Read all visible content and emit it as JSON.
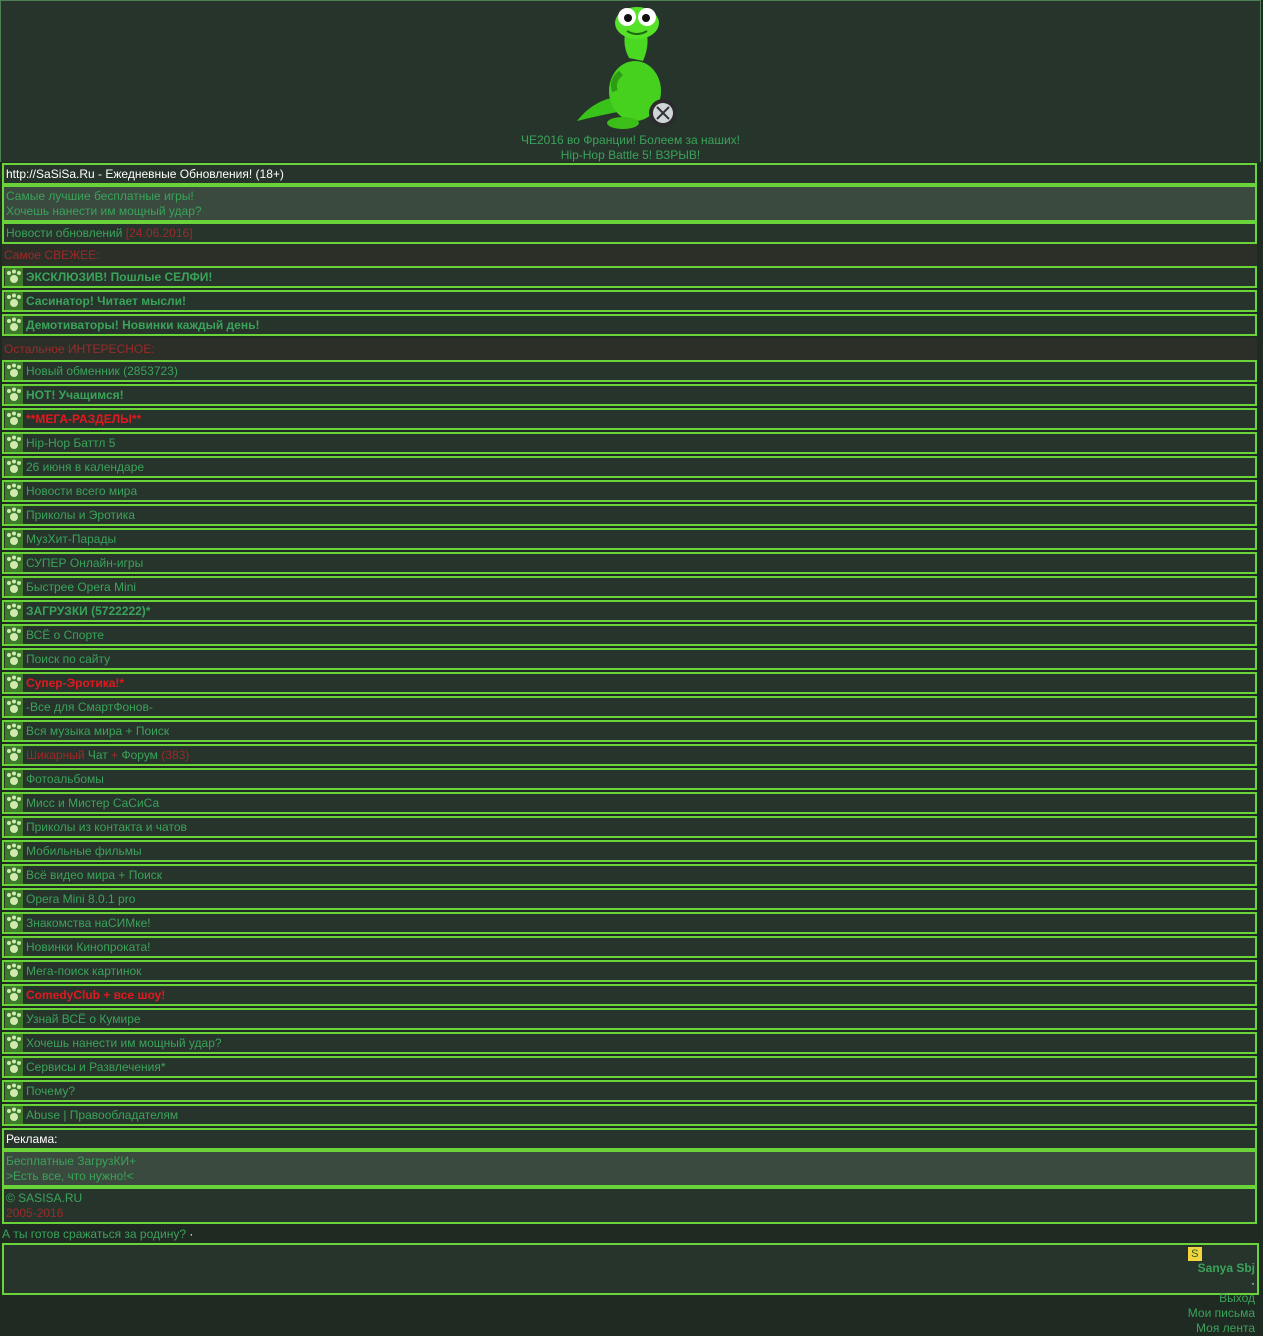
{
  "header": {
    "links": [
      "ЧЕ2016 во Франции! Болеем за наших!",
      "Hip-Hop Battle 5! ВЗРЫВ!"
    ]
  },
  "site_title": "http://SaSiSa.Ru - Ежедневные Обновления! (18+)",
  "promo1": [
    "Самые лучшие бесплатные игры!",
    "Хочешь нанести им мощный удар?"
  ],
  "news": {
    "label": "Новости обновлений",
    "date": "[24.06.2016]"
  },
  "section_hot": "Самое СВЕЖЕЕ:",
  "hot_items": [
    "ЭКСКЛЮЗИВ! Пошлые СЕЛФИ!",
    "Сасинатор! Читает мысли!",
    "Демотиваторы! Новинки каждый день!"
  ],
  "section_other": "Остальное ИНТЕРЕСНОЕ:",
  "items": [
    {
      "label": "Новый обменник (2853723)",
      "style": "normal"
    },
    {
      "label": "НОТ! Учащимся!",
      "style": "bold"
    },
    {
      "label": "**МЕГА-РАЗДЕЛЫ**",
      "style": "red-bold"
    },
    {
      "label": "Hip-Hop Баттл 5",
      "style": "normal"
    },
    {
      "label": "26 июня в календаре",
      "style": "normal"
    },
    {
      "label": "Новости всего мира",
      "style": "normal"
    },
    {
      "label": "Приколы и Эротика",
      "style": "normal"
    },
    {
      "label": "МузХит-Парады",
      "style": "normal"
    },
    {
      "label": "СУПЕР Онлайн-игры",
      "style": "normal"
    },
    {
      "label": "Быстрее Opera Mini",
      "style": "normal"
    },
    {
      "label": "ЗАГРУЗКИ (5722222)*",
      "style": "bold"
    },
    {
      "label": "ВСЁ о Спорте",
      "style": "normal"
    },
    {
      "label": "Поиск по сайту",
      "style": "normal"
    },
    {
      "label": "Супер-Эротика!*",
      "style": "red-bold"
    },
    {
      "label": "-Все для СмартФонов-",
      "style": "normal"
    },
    {
      "label": "Вся музыка мира + Поиск",
      "style": "normal"
    }
  ],
  "chat": {
    "part1": "Шикарный",
    "part2": "Чат",
    "part3": "+",
    "part4": "Форум",
    "count": "(383)"
  },
  "items2": [
    {
      "label": "Фотоальбомы",
      "style": "normal"
    },
    {
      "label": "Мисс и Мистер СаСиСа",
      "style": "normal"
    },
    {
      "label": "Приколы из контакта и чатов",
      "style": "normal"
    },
    {
      "label": "Мобильные фильмы",
      "style": "normal"
    },
    {
      "label": "Всё видео мира + Поиск",
      "style": "normal"
    },
    {
      "label": "Opera Mini 8.0.1 pro",
      "style": "normal"
    },
    {
      "label": "Знакомства наСИМке!",
      "style": "normal"
    },
    {
      "label": "Новинки Кинопроката!",
      "style": "normal"
    },
    {
      "label": "Мега-поиск картинок",
      "style": "normal"
    },
    {
      "label": "ComedyClub + все шоу!",
      "style": "red-bold"
    },
    {
      "label": "Узнай ВСЁ о Кумире",
      "style": "normal"
    },
    {
      "label": "Хочешь нанести им мощный удар?",
      "style": "normal"
    },
    {
      "label": "Сервисы и Развлечения*",
      "style": "normal"
    },
    {
      "label": "Почему?",
      "style": "normal"
    },
    {
      "label": "Abuse | Правообладателям",
      "style": "normal"
    }
  ],
  "ads_label": "Реклама:",
  "promo2": [
    "Бесплатные ЗагрузКИ+",
    ">Есть все, что нужно!<"
  ],
  "copyright": {
    "line1": "© SASISA.RU",
    "line2": "2005-2016"
  },
  "question": "А ты готов сражаться за родину?",
  "question_suffix": " ·",
  "user": {
    "name": "Sanya Sbj",
    "logout": "Выход",
    "sep": "·",
    "mail": "Мои письма",
    "feed": "Моя лента"
  },
  "colors": {
    "bg": "#1f2a23",
    "row": "#27342b",
    "border": "#6ad33a",
    "link": "#3aa35a",
    "accent_red": "#e2181f"
  }
}
